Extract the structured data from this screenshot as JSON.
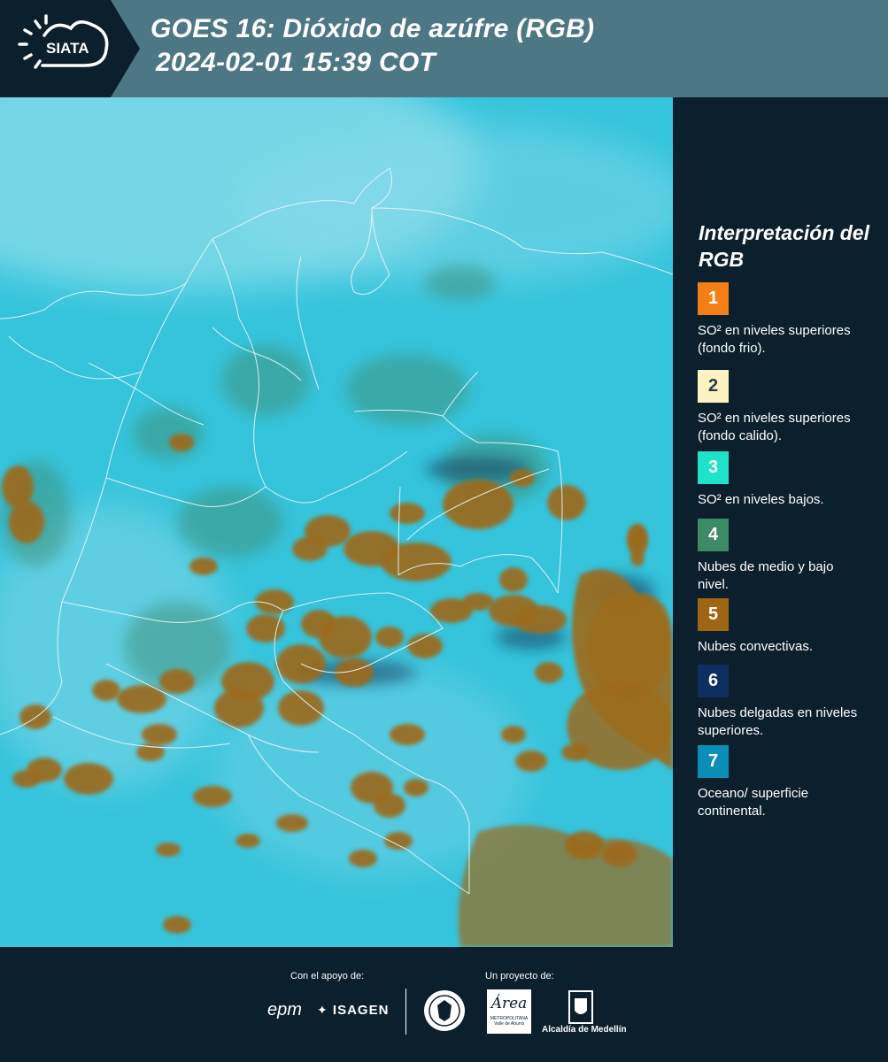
{
  "header": {
    "logo_text": "SIATA",
    "title_line1": "GOES 16: Dióxido de azúfre (RGB)",
    "title_line2": "2024-02-01 15:39 COT"
  },
  "legend": {
    "title": "Interpretación del RGB",
    "items": [
      {
        "number": "1",
        "color": "#f57f17",
        "label": "SO² en niveles superiores (fondo frio)."
      },
      {
        "number": "2",
        "color": "#fdf3c2",
        "label": "SO² en niveles superiores (fondo calido)."
      },
      {
        "number": "3",
        "color": "#1fe3c8",
        "label": "SO² en niveles bajos."
      },
      {
        "number": "4",
        "color": "#3e8a67",
        "label": "Nubes de medio y bajo nivel."
      },
      {
        "number": "5",
        "color": "#a06512",
        "label": "Nubes convectivas."
      },
      {
        "number": "6",
        "color": "#0e2f60",
        "label": "Nubes delgadas en niveles superiores."
      },
      {
        "number": "7",
        "color": "#0b8fb8",
        "label": "Oceano/ superficie continental."
      }
    ]
  },
  "footer": {
    "support_label": "Con el apoyo de:",
    "project_label": "Un proyecto de:",
    "sponsor_epm": "epm",
    "sponsor_isagen": "ISAGEN",
    "sponsor_area": "Área",
    "sponsor_area_sub": "METROPOLITANA",
    "sponsor_area_sub2": "Valle de Aburrá",
    "sponsor_alcaldia": "Alcaldía de Medellín"
  },
  "colors": {
    "header_bg": "#4e7785",
    "panel_bg": "#0c1f2c",
    "map_background": "#35c4dc",
    "convective_cloud": "#9c6b1c"
  }
}
